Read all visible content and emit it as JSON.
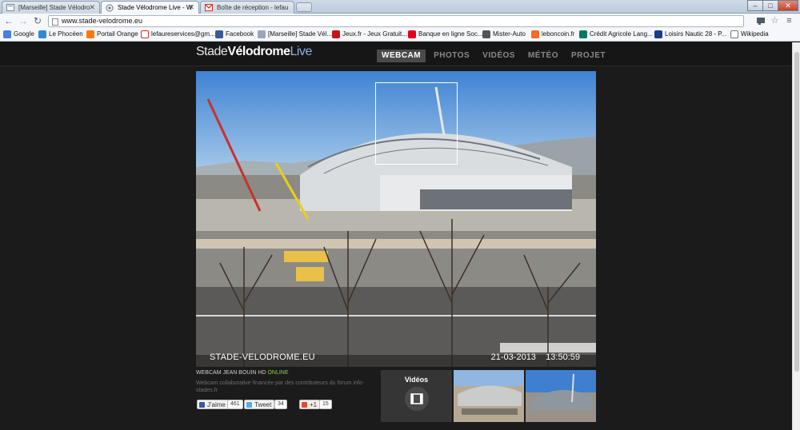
{
  "browser": {
    "tabs": [
      {
        "title": "[Marseille] Stade Vélodro",
        "active": false
      },
      {
        "title": "Stade Vélodrome Live - W",
        "active": true
      },
      {
        "title": "Boîte de réception - lefau",
        "active": false
      }
    ],
    "url": "www.stade-velodrome.eu",
    "window_controls": [
      "–",
      "□",
      "✕"
    ],
    "bookmarks": [
      {
        "label": "Google",
        "icon": "google-icon",
        "color": "#4a7fe0"
      },
      {
        "label": "Le Phocéen",
        "icon": "phoceen-icon",
        "color": "#2c8bd8"
      },
      {
        "label": "Portail Orange",
        "icon": "orange-icon",
        "color": "#ff7900"
      },
      {
        "label": "lefaureservices@gm...",
        "icon": "gmail-icon",
        "color": "#d93025"
      },
      {
        "label": "Facebook",
        "icon": "facebook-icon",
        "color": "#3b5998"
      },
      {
        "label": "[Marseille] Stade Vél...",
        "icon": "page-icon",
        "color": "#9aa7b5"
      },
      {
        "label": "Jeux.fr - Jeux Gratuit...",
        "icon": "jeux-icon",
        "color": "#c4161c"
      },
      {
        "label": "Banque en ligne Soc...",
        "icon": "bank-icon",
        "color": "#e2001a"
      },
      {
        "label": "Mister-Auto",
        "icon": "mister-auto-icon",
        "color": "#555555"
      },
      {
        "label": "leboncoin.fr",
        "icon": "leboncoin-icon",
        "color": "#f56b2a"
      },
      {
        "label": "Crédit Agricole Lang...",
        "icon": "ca-icon",
        "color": "#007a5e"
      },
      {
        "label": "Loisirs Nautic 28 - P...",
        "icon": "loisirs-icon",
        "color": "#1c3d8c"
      },
      {
        "label": "Wikipedia",
        "icon": "wikipedia-icon",
        "color": "#777777"
      }
    ]
  },
  "site": {
    "logo": {
      "part1": "Stade",
      "part2": "Vélodrome",
      "part3": "Live"
    },
    "nav": [
      {
        "label": "WEBCAM",
        "active": true
      },
      {
        "label": "PHOTOS",
        "active": false
      },
      {
        "label": "VIDÉOS",
        "active": false
      },
      {
        "label": "MÉTÉO",
        "active": false
      },
      {
        "label": "PROJET",
        "active": false
      }
    ],
    "webcam": {
      "overlay_label": "STADE-VELODROME.EU",
      "date": "21-03-2013",
      "time": "13:50:59",
      "caption_main": "WEBCAM JEAN BOUIN HD",
      "caption_status": "ONLINE",
      "description": "Webcam collaborative financée par des contributeurs du forum info-stades.fr"
    },
    "social": {
      "facebook_label": "J'aime",
      "facebook_count": "461",
      "twitter_label": "Tweet",
      "twitter_count": "34",
      "gplus_label": "+1",
      "gplus_count": "15"
    },
    "videos_panel": {
      "title": "Vidéos",
      "icon": "film-icon"
    },
    "colors": {
      "accent_blue": "#8fb2dc",
      "online_green": "#8bd14d",
      "nav_active_bg": "#4a4a4a"
    }
  }
}
